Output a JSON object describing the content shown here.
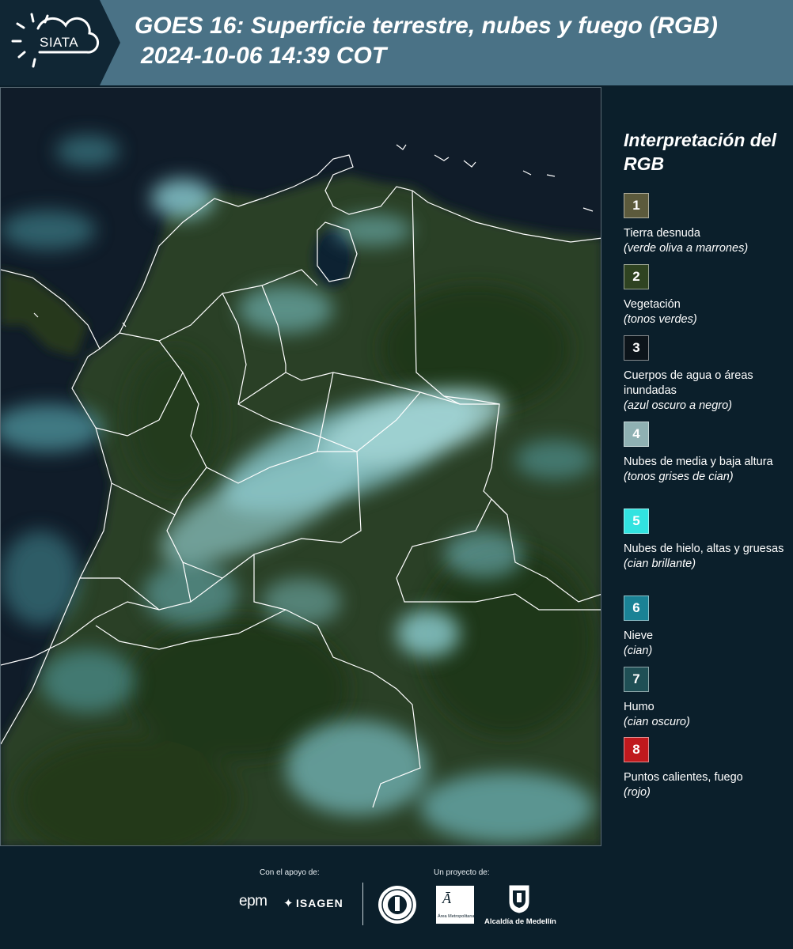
{
  "header": {
    "logo_text": "SIATA",
    "title": "GOES 16: Superficie terrestre, nubes y fuego (RGB)",
    "subtitle": "2024-10-06 14:39 COT"
  },
  "legend": {
    "title": "Interpretación del RGB",
    "items": [
      {
        "number": "1",
        "label": "Tierra desnuda",
        "sub": "(verde oliva a marrones)",
        "color": "#5c5a3c"
      },
      {
        "number": "2",
        "label": "Vegetación",
        "sub": "(tonos verdes)",
        "color": "#2f4321"
      },
      {
        "number": "3",
        "label": "Cuerpos de agua o áreas inundadas",
        "sub": "(azul oscuro a negro)",
        "color": "#0c141a"
      },
      {
        "number": "4",
        "label": "Nubes de media y baja altura",
        "sub": "(tonos grises de cian)",
        "color": "#8fb1b3"
      },
      {
        "number": "5",
        "label": "Nubes de hielo, altas y gruesas",
        "sub": "(cian brillante)",
        "color": "#31e3e0"
      },
      {
        "number": "6",
        "label": "Nieve",
        "sub": "(cian)",
        "color": "#1a8295"
      },
      {
        "number": "7",
        "label": "Humo",
        "sub": "(cian oscuro)",
        "color": "#1f4f55"
      },
      {
        "number": "8",
        "label": "Puntos calientes, fuego",
        "sub": "(rojo)",
        "color": "#c0191d"
      }
    ]
  },
  "footer": {
    "support_label": "Con el apoyo de:",
    "project_label": "Un proyecto de:",
    "sponsor_1": "epm",
    "sponsor_2": "ISAGEN",
    "partner_1": "Área Metropolitana",
    "partner_2": "Alcaldía de Medellín"
  }
}
